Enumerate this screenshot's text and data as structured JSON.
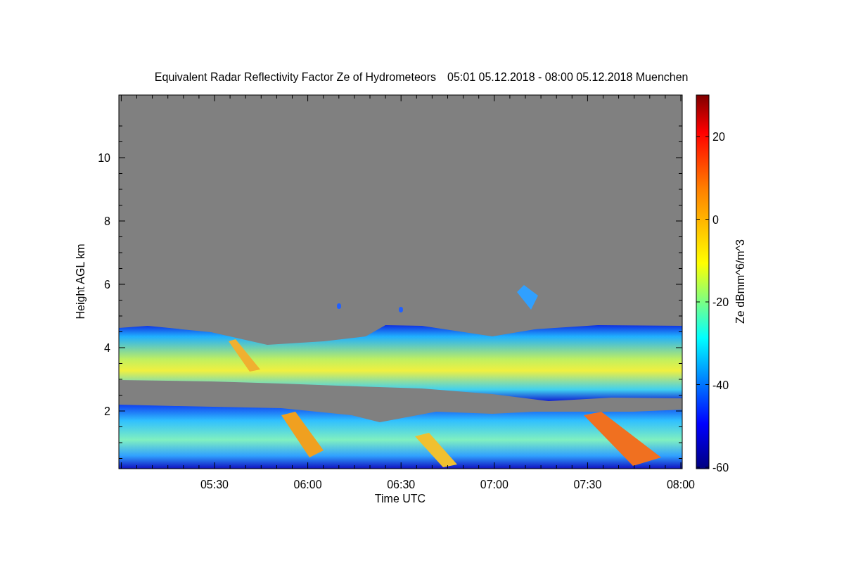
{
  "title": "Equivalent Radar Reflectivity Factor Ze of Hydrometeors",
  "period": "05:01 05.12.2018 - 08:00 05.12.2018 Muenchen",
  "ylabel": "Height AGL km",
  "xlabel": "Time UTC",
  "yticks": [
    "10",
    "8",
    "6",
    "4",
    "2"
  ],
  "xticks": [
    "05:30",
    "06:00",
    "06:30",
    "07:00",
    "07:30",
    "08:00"
  ],
  "colorbar": {
    "label": "Ze dBmm^6/m^3",
    "ticks": [
      "20",
      "0",
      "-20",
      "-40",
      "-60"
    ]
  }
}
